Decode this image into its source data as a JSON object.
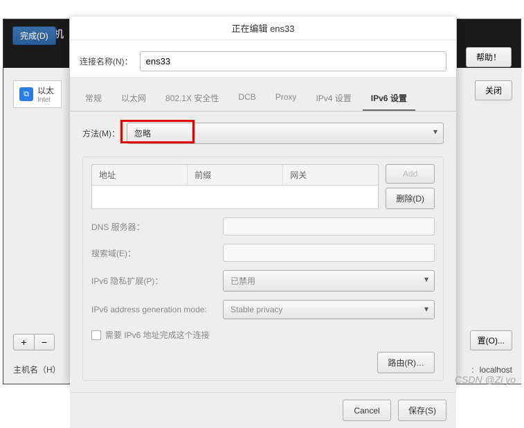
{
  "main": {
    "title": "网络和主机",
    "done_label": "完成(D)",
    "help_label": "帮助！",
    "device_name": "以太",
    "device_sub": "Intel",
    "close_label": "关闭",
    "plus_label": "+",
    "minus_label": "−",
    "config_label": "置(O)...",
    "hostname_label": "主机名（H）",
    "hostname_suffix": ":",
    "localhost_label": "localhost"
  },
  "dialog": {
    "title": "正在编辑 ens33",
    "conn_label": "连接名称(N)：",
    "conn_value": "ens33",
    "tabs": [
      "常规",
      "以太网",
      "802.1X 安全性",
      "DCB",
      "Proxy",
      "IPv4 设置",
      "IPv6 设置"
    ],
    "active_tab_index": 6,
    "method_label": "方法(M)：",
    "method_value": "忽略",
    "addr_headers": [
      "地址",
      "前缀",
      "网关"
    ],
    "add_label": "Add",
    "delete_label": "删除(D)",
    "dns_label": "DNS 服务器：",
    "search_label": "搜索域(E)：",
    "privacy_label": "IPv6 隐私扩展(P)：",
    "privacy_value": "已禁用",
    "genmode_label": "IPv6 address generation mode:",
    "genmode_value": "Stable privacy",
    "require_label": "需要 IPv6 地址完成这个连接",
    "route_label": "路由(R)…",
    "cancel_label": "Cancel",
    "save_label": "保存(S)"
  },
  "watermark": "CSDN @Zi yo"
}
